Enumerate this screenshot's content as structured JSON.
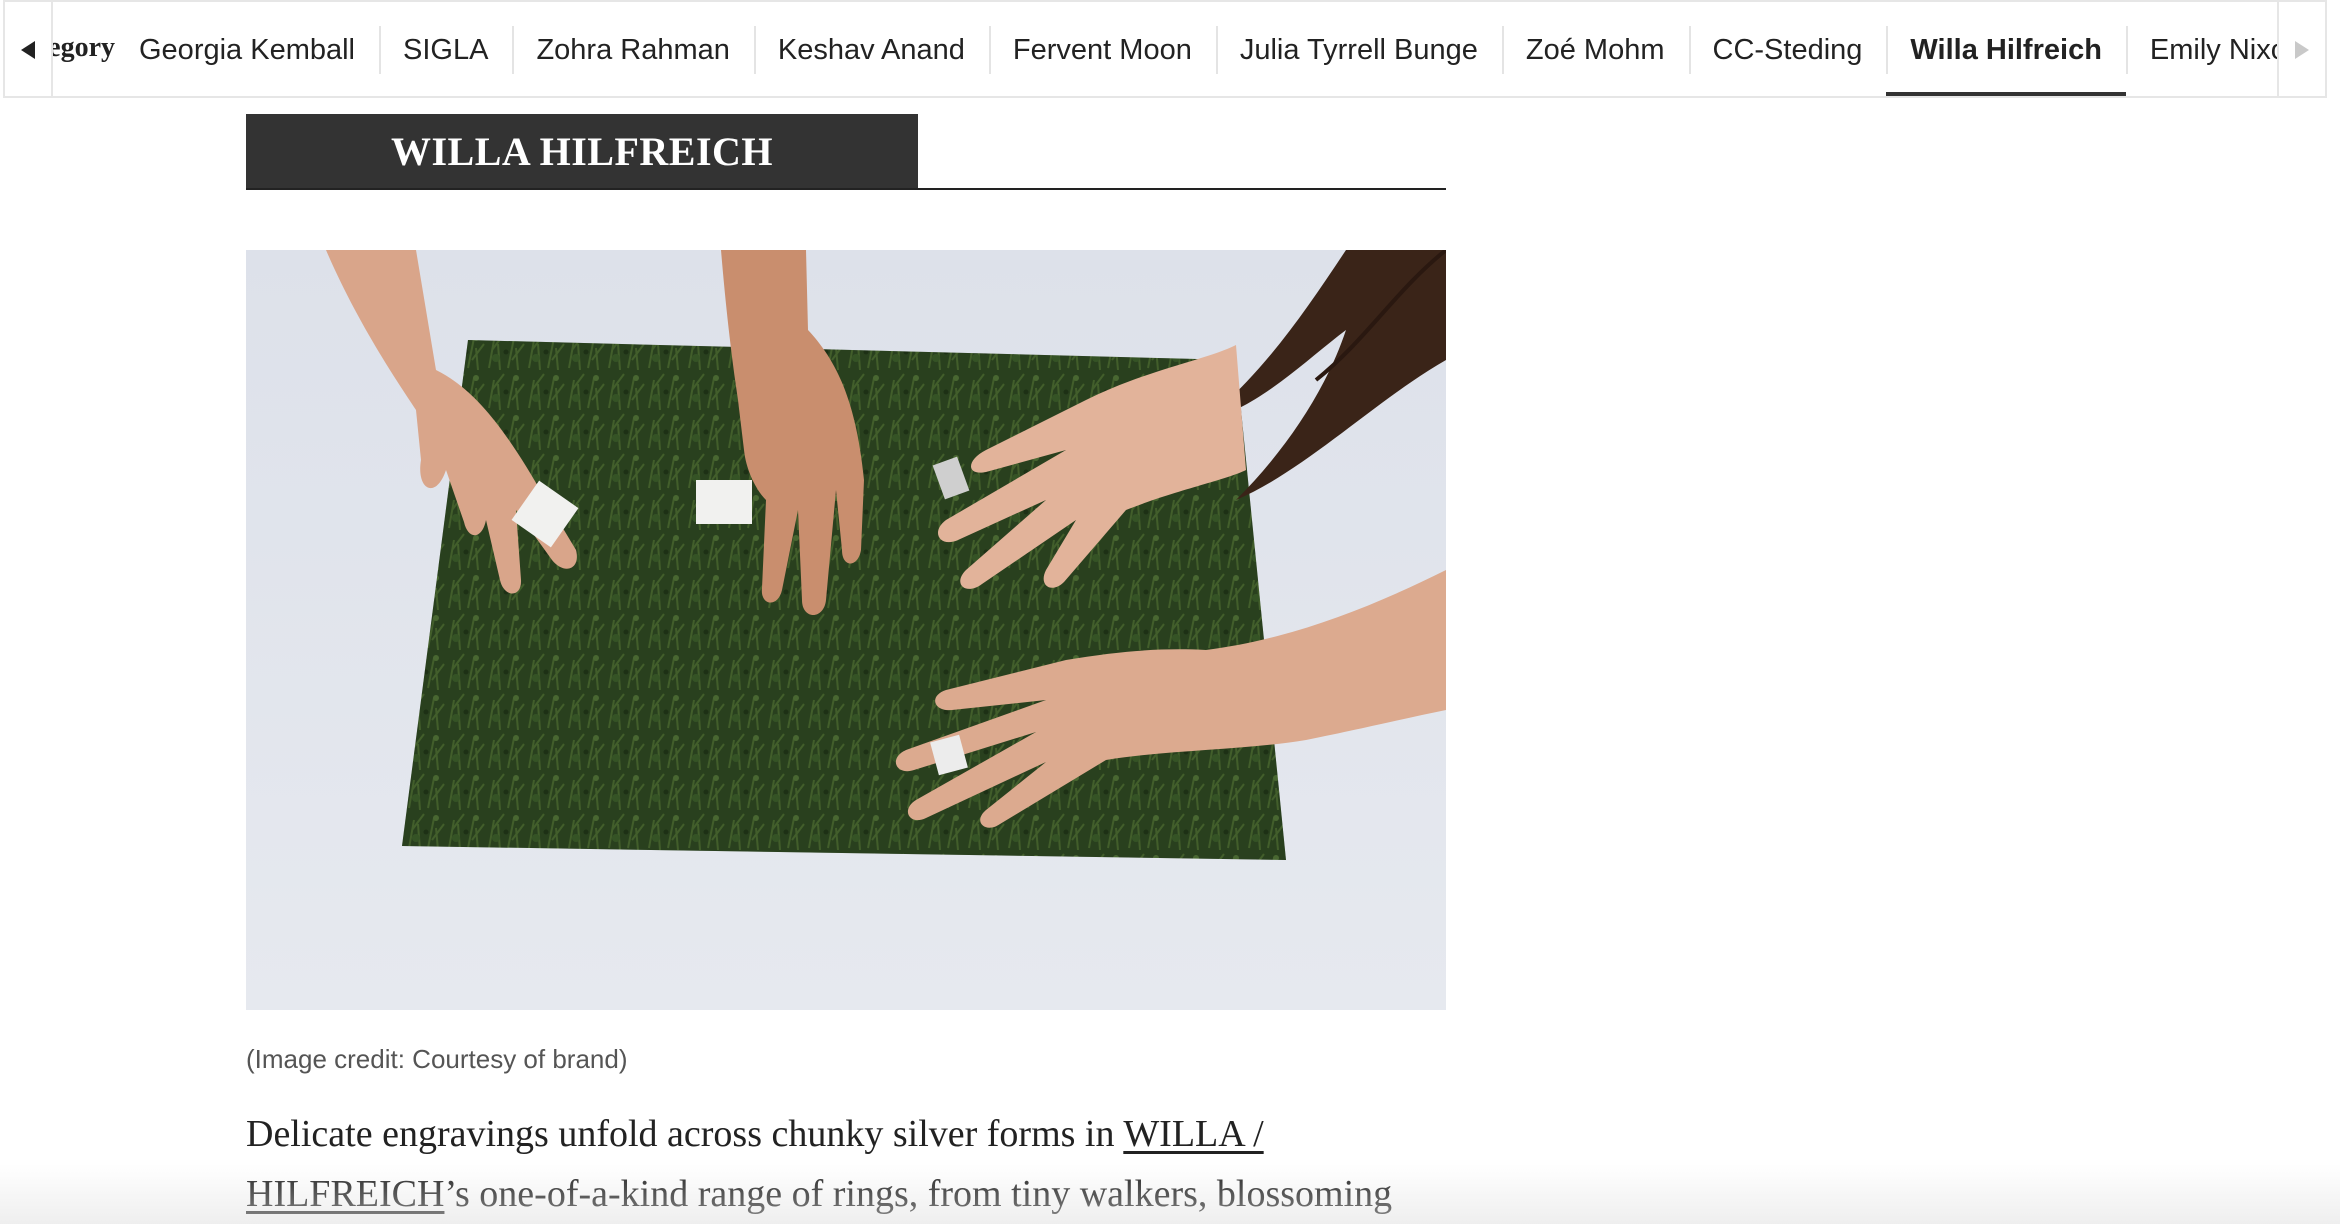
{
  "carousel": {
    "category_label": "Category:",
    "prev_icon": "chevron-left-icon",
    "next_icon": "chevron-right-icon",
    "tabs": [
      {
        "label": "Georgia Kemball"
      },
      {
        "label": "SIGLA"
      },
      {
        "label": "Zohra Rahman"
      },
      {
        "label": "Keshav Anand"
      },
      {
        "label": "Fervent Moon"
      },
      {
        "label": "Julia Tyrrell Bunge"
      },
      {
        "label": "Zoé Mohm"
      },
      {
        "label": "CC-Steding"
      },
      {
        "label": "Willa Hilfreich",
        "active": true
      },
      {
        "label": "Emily Nixon"
      }
    ]
  },
  "article": {
    "heading": "WILLA HILFREICH",
    "image_caption": "(Image credit: Courtesy of brand)",
    "body": {
      "intro": "Delicate engravings unfold across chunky silver forms in ",
      "link_text": "WILLA / HILFREICH",
      "rest": "’s one-of-a-kind range of rings, from tiny walkers, blossoming"
    }
  },
  "colors": {
    "heading_bg": "#333333",
    "active_tab_underline": "#333333",
    "photo_backdrop": "#dfe3ea",
    "grass": "#2f4a22"
  }
}
